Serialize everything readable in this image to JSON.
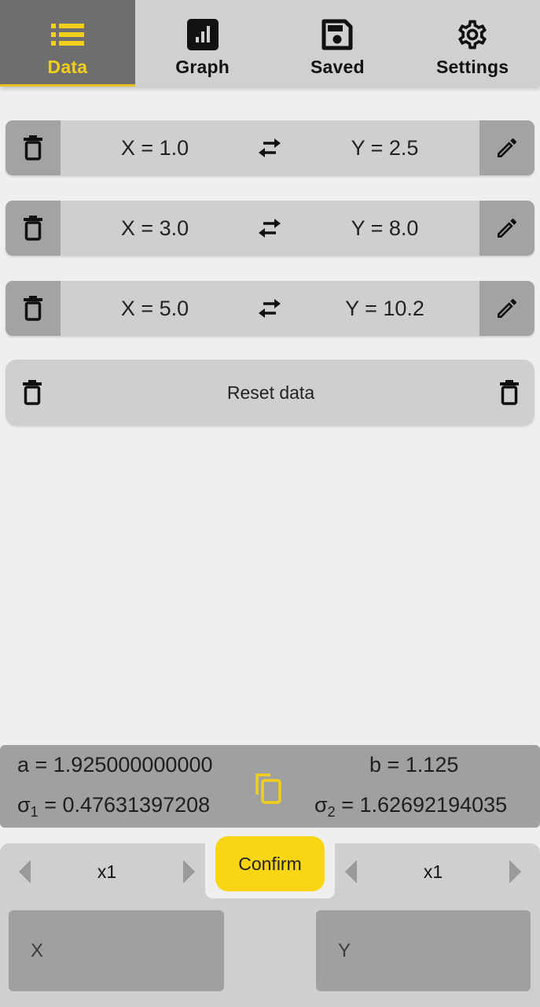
{
  "nav": {
    "tabs": [
      {
        "label": "Data",
        "icon": "list-icon",
        "active": true
      },
      {
        "label": "Graph",
        "icon": "bar-chart-icon",
        "active": false
      },
      {
        "label": "Saved",
        "icon": "floppy-disk-icon",
        "active": false
      },
      {
        "label": "Settings",
        "icon": "gear-icon",
        "active": false
      }
    ]
  },
  "data_points": [
    {
      "x_label": "X = 1.0",
      "y_label": "Y = 2.5"
    },
    {
      "x_label": "X = 3.0",
      "y_label": "Y = 8.0"
    },
    {
      "x_label": "X = 5.0",
      "y_label": "Y = 10.2"
    }
  ],
  "reset": {
    "label": "Reset data"
  },
  "results": {
    "a_label": "a = 1.925000000000",
    "b_label": "b = 1.125",
    "sigma1_prefix": "σ",
    "sigma1_sub": "1",
    "sigma1_value": " = 0.47631397208",
    "sigma2_prefix": "σ",
    "sigma2_sub": "2",
    "sigma2_value": " = 1.62692194035"
  },
  "input": {
    "x_multiplier": "x1",
    "y_multiplier": "x1",
    "confirm_label": "Confirm",
    "x_placeholder": "X",
    "y_placeholder": "Y"
  },
  "colors": {
    "accent": "#fad514",
    "active_tab_bg": "#6e6e6e",
    "active_tab_text": "#f2cf1a"
  }
}
